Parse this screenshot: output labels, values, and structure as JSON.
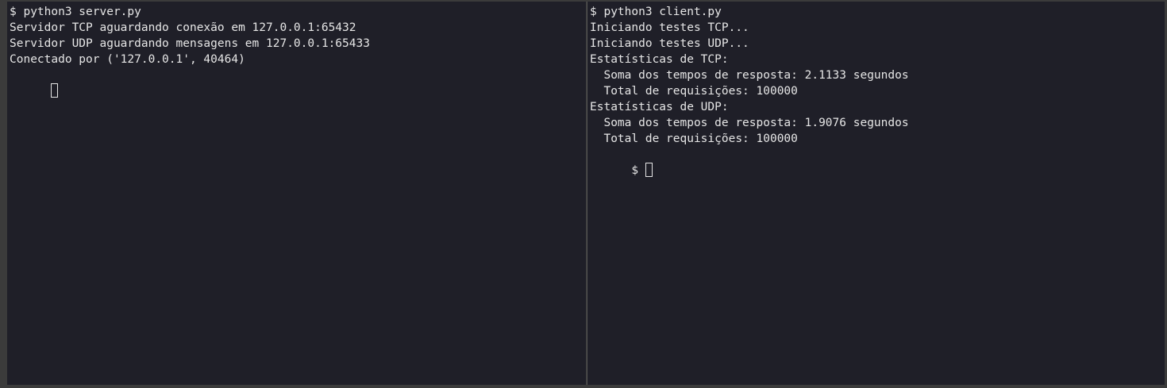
{
  "left_pane": {
    "lines": [
      "$ python3 server.py",
      "Servidor TCP aguardando conexão em 127.0.0.1:65432",
      "Servidor UDP aguardando mensagens em 127.0.0.1:65433",
      "Conectado por ('127.0.0.1', 40464)"
    ],
    "prompt": ""
  },
  "right_pane": {
    "lines": [
      "$ python3 client.py",
      "Iniciando testes TCP...",
      "Iniciando testes UDP...",
      "Estatísticas de TCP:",
      "  Soma dos tempos de resposta: 2.1133 segundos",
      "  Total de requisições: 100000",
      "Estatísticas de UDP:",
      "  Soma dos tempos de resposta: 1.9076 segundos",
      "  Total de requisições: 100000"
    ],
    "prompt": "$ "
  }
}
